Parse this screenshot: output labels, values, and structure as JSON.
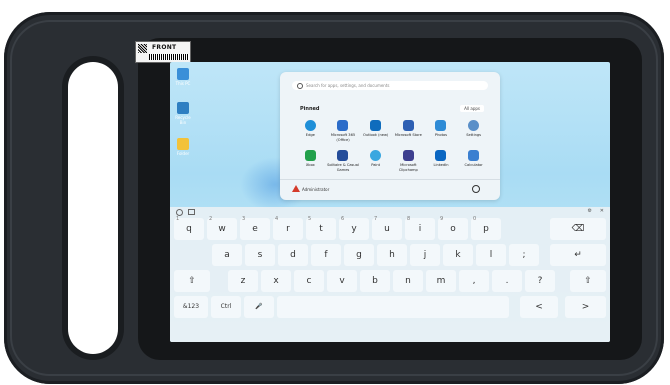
{
  "sticker": {
    "label": "FRONT"
  },
  "desktop": {
    "icons": [
      {
        "label": "This PC",
        "color": "#3a8fd8"
      },
      {
        "label": "Recycle Bin",
        "color": "#2e7fc2"
      },
      {
        "label": "Folder",
        "color": "#f2c23a"
      }
    ]
  },
  "start_menu": {
    "search_placeholder": "Search for apps, settings, and documents",
    "pinned_label": "Pinned",
    "all_apps_label": "All apps",
    "apps": [
      {
        "label": "Edge",
        "color": "#1f8fd8"
      },
      {
        "label": "Microsoft 365 (Office)",
        "color": "#2b6cc9"
      },
      {
        "label": "Outlook (new)",
        "color": "#0f6cbd"
      },
      {
        "label": "Microsoft Store",
        "color": "#2d5fb3"
      },
      {
        "label": "Photos",
        "color": "#2e8bd6"
      },
      {
        "label": "Settings",
        "color": "#5a8fc8"
      },
      {
        "label": "Xbox",
        "color": "#22a04b"
      },
      {
        "label": "Solitaire & Casual Games",
        "color": "#244d9a"
      },
      {
        "label": "Paint",
        "color": "#3aa7e0"
      },
      {
        "label": "Microsoft Clipchamp",
        "color": "#3d3f8f"
      },
      {
        "label": "LinkedIn",
        "color": "#0a66c2"
      },
      {
        "label": "Calculator",
        "color": "#3b7fd0"
      }
    ],
    "user_name": "Administrator"
  },
  "keyboard": {
    "toolbar": {
      "settings": "⚙",
      "close": "✕"
    },
    "row1": [
      "q",
      "w",
      "e",
      "r",
      "t",
      "y",
      "u",
      "i",
      "o",
      "p"
    ],
    "row1_hints": [
      "1",
      "2",
      "3",
      "4",
      "5",
      "6",
      "7",
      "8",
      "9",
      "0"
    ],
    "backspace": "⌫",
    "row2": [
      "a",
      "s",
      "d",
      "f",
      "g",
      "h",
      "j",
      "k",
      "l"
    ],
    "row2_extra": [
      ";",
      "'"
    ],
    "enter": "↵",
    "shift": "⇧",
    "row3": [
      "z",
      "x",
      "c",
      "v",
      "b",
      "n",
      "m"
    ],
    "row3_punct": [
      ",",
      ".",
      "?"
    ],
    "symbols": "&123",
    "ctrl": "Ctrl",
    "mic": "🎤",
    "left": "<",
    "right": ">"
  }
}
